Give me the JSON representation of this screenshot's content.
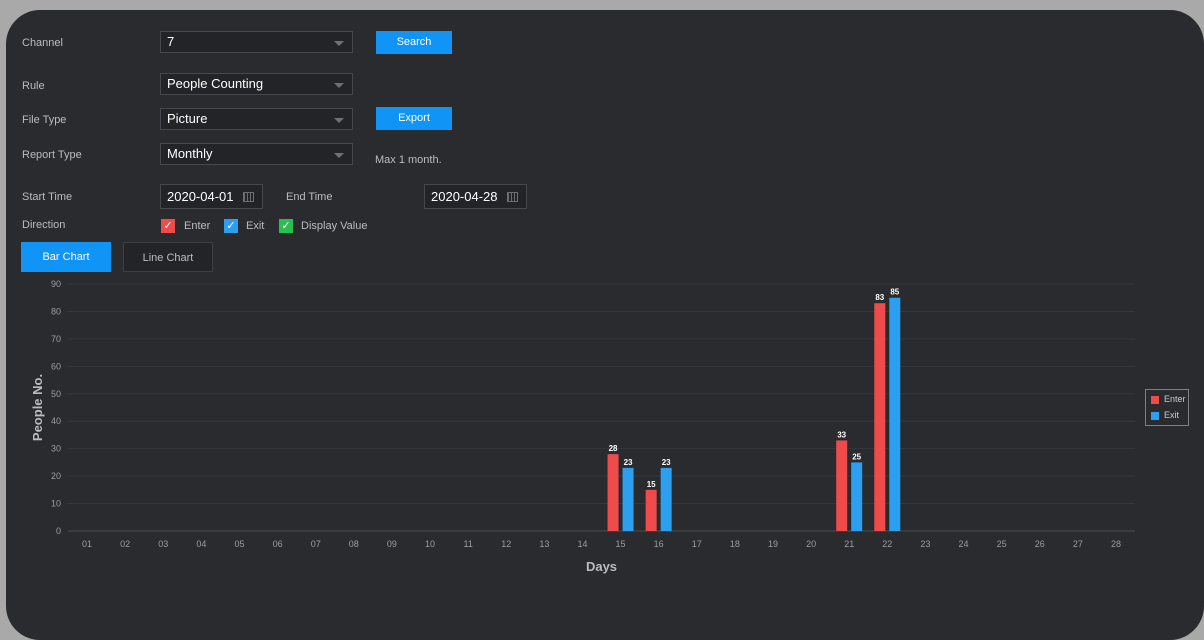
{
  "form": {
    "channel_label": "Channel",
    "channel_value": "7",
    "search_label": "Search",
    "rule_label": "Rule",
    "rule_value": "People Counting",
    "file_type_label": "File Type",
    "file_type_value": "Picture",
    "export_label": "Export",
    "report_type_label": "Report Type",
    "report_type_value": "Monthly",
    "max_note": "Max 1 month.",
    "start_time_label": "Start Time",
    "start_time_value": "2020-04-01",
    "end_time_label": "End Time",
    "end_time_value": "2020-04-28",
    "direction_label": "Direction",
    "direction_options": [
      {
        "label": "Enter",
        "checked": true,
        "color": "#ef4b4b"
      },
      {
        "label": "Exit",
        "checked": true,
        "color": "#2c9ff0"
      },
      {
        "label": "Display Value",
        "checked": true,
        "color": "#29c04f"
      }
    ]
  },
  "tabs": [
    {
      "label": "Bar Chart",
      "active": true
    },
    {
      "label": "Line Chart",
      "active": false
    }
  ],
  "colors": {
    "accent": "#1094f6",
    "enter": "#ef4b4b",
    "exit": "#2c9ff0",
    "check_green": "#29c04f",
    "background": "#2a2b2f"
  },
  "chart_data": {
    "type": "bar",
    "xlabel": "Days",
    "ylabel": "People No.",
    "ylim": [
      0,
      90
    ],
    "yticks": [
      0,
      10,
      20,
      30,
      40,
      50,
      60,
      70,
      80,
      90
    ],
    "categories": [
      "01",
      "02",
      "03",
      "04",
      "05",
      "06",
      "07",
      "08",
      "09",
      "10",
      "11",
      "12",
      "13",
      "14",
      "15",
      "16",
      "17",
      "18",
      "19",
      "20",
      "21",
      "22",
      "23",
      "24",
      "25",
      "26",
      "27",
      "28"
    ],
    "series": [
      {
        "name": "Enter",
        "color": "#ef4b4b",
        "values": [
          0,
          0,
          0,
          0,
          0,
          0,
          0,
          0,
          0,
          0,
          0,
          0,
          0,
          0,
          28,
          15,
          0,
          0,
          0,
          0,
          33,
          83,
          0,
          0,
          0,
          0,
          0,
          0
        ]
      },
      {
        "name": "Exit",
        "color": "#2c9ff0",
        "values": [
          0,
          0,
          0,
          0,
          0,
          0,
          0,
          0,
          0,
          0,
          0,
          0,
          0,
          0,
          23,
          23,
          0,
          0,
          0,
          0,
          25,
          85,
          0,
          0,
          0,
          0,
          0,
          0
        ]
      }
    ],
    "show_values": true,
    "grid": true,
    "legend_position": "right"
  }
}
